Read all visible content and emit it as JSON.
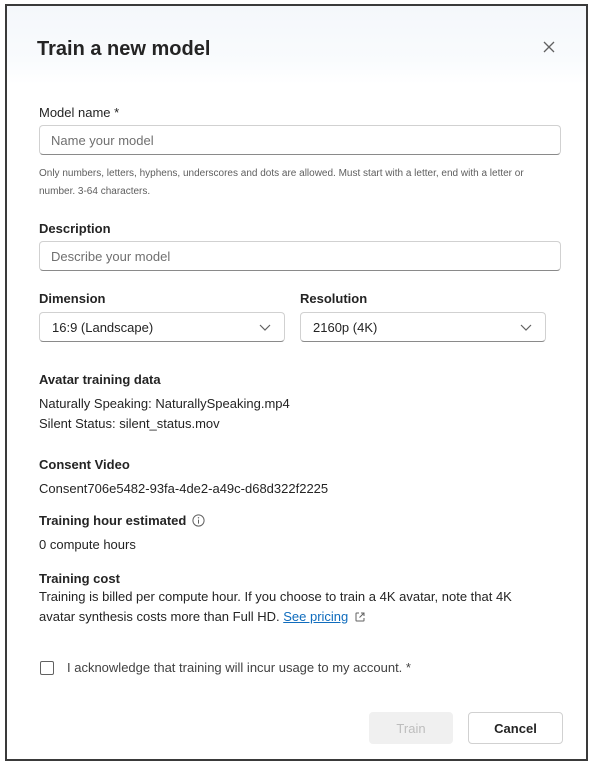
{
  "dialog": {
    "title": "Train a new model",
    "close_icon": "close-icon"
  },
  "model_name": {
    "label": "Model name *",
    "placeholder": "Name your model",
    "hint": "Only numbers, letters, hyphens, underscores and dots are allowed. Must start with a letter, end with a letter or number. 3-64 characters."
  },
  "description": {
    "label": "Description",
    "placeholder": "Describe your model"
  },
  "dimension": {
    "label": "Dimension",
    "value": "16:9 (Landscape)"
  },
  "resolution": {
    "label": "Resolution",
    "value": "2160p (4K)"
  },
  "avatar_training_data": {
    "heading": "Avatar training data",
    "line1": "Naturally Speaking: NaturallySpeaking.mp4",
    "line2": "Silent Status: silent_status.mov"
  },
  "consent_video": {
    "heading": "Consent Video",
    "value": "Consent706e5482-93fa-4de2-a49c-d68d322f2225"
  },
  "training_hour": {
    "heading": "Training hour estimated",
    "value": "0 compute hours",
    "info_icon": "info-icon"
  },
  "training_cost": {
    "heading": "Training cost",
    "line1": "Training is billed per compute hour. If you choose to train a 4K avatar, note that 4K",
    "line2": "avatar synthesis costs more than Full HD.",
    "link": "See pricing",
    "external_icon": "external-link-icon"
  },
  "acknowledge": {
    "label": "I acknowledge that training will incur usage to my account. *",
    "checked": false
  },
  "footer": {
    "train_label": "Train",
    "cancel_label": "Cancel"
  }
}
